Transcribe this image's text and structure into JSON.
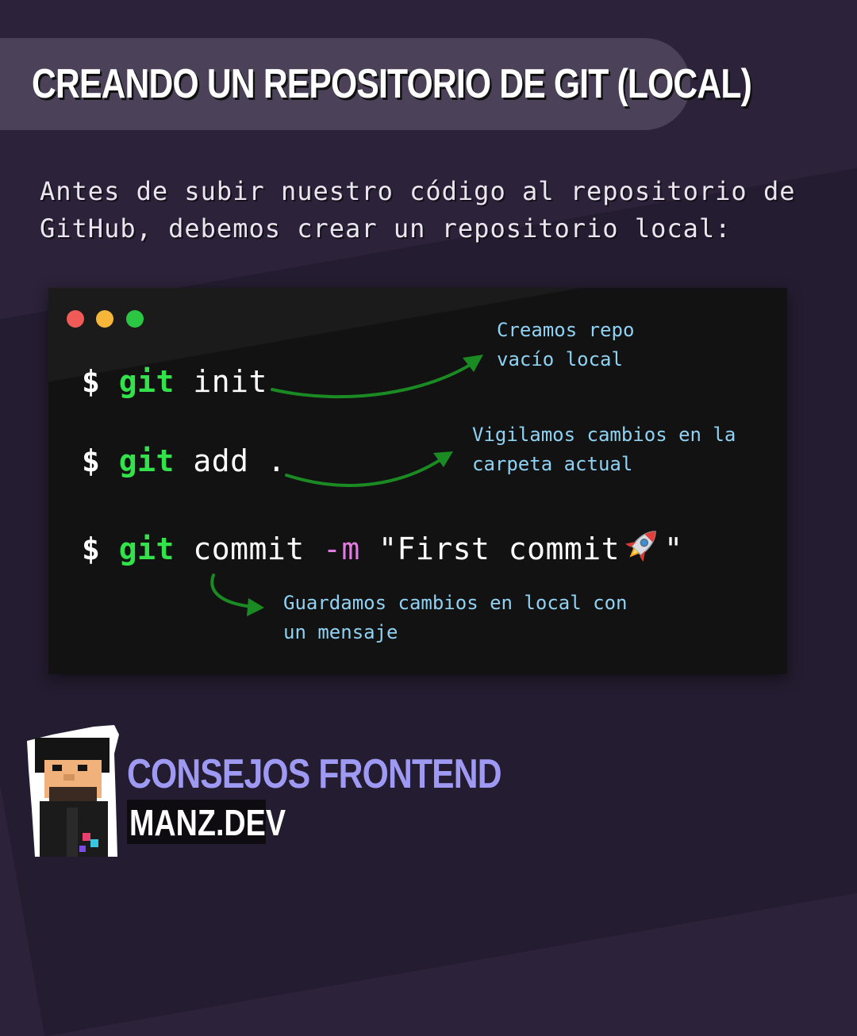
{
  "header": {
    "title": "CREANDO UN REPOSITORIO DE GIT (LOCAL)"
  },
  "intro": {
    "text": "Antes de subir nuestro código al repositorio de GitHub, debemos crear un repositorio local:"
  },
  "terminal": {
    "commands": [
      {
        "prompt": "$",
        "tool": "git",
        "args": "init"
      },
      {
        "prompt": "$",
        "tool": "git",
        "args": "add ."
      },
      {
        "prompt": "$",
        "tool": "git",
        "args_before_flag": "commit",
        "flag": "-m",
        "message": "\"First commit",
        "message_end": "\"",
        "emoji": "rocket-icon"
      }
    ],
    "annotations": [
      "Creamos repo\nvacío local",
      "Vigilamos cambios en la\ncarpeta actual",
      "Guardamos cambios en local con\nun mensaje"
    ]
  },
  "brand": {
    "title": "CONSEJOS FRONTEND",
    "site": "MANZ.DEV"
  },
  "colors": {
    "background": "#2c2239",
    "git": "#33e24a",
    "flag": "#e07be0",
    "annotation": "#8fd2f3",
    "arrow": "#1a8a22",
    "brand": "#9e9af3"
  }
}
